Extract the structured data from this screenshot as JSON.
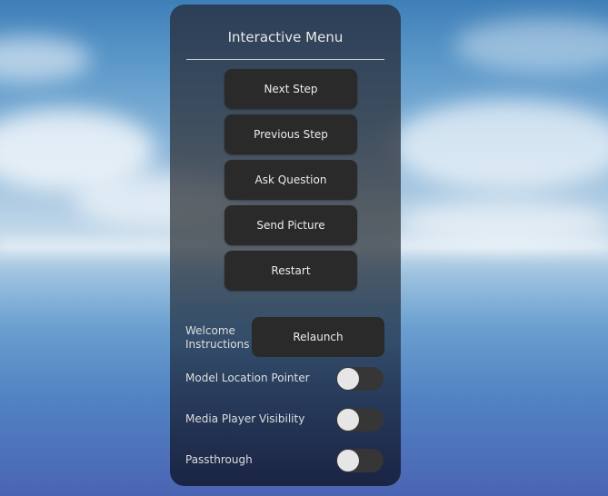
{
  "menu": {
    "title": "Interactive Menu",
    "buttons": [
      "Next Step",
      "Previous Step",
      "Ask Question",
      "Send Picture",
      "Restart"
    ]
  },
  "welcome": {
    "label_line1": "Welcome",
    "label_line2": "Instructions",
    "button_label": "Relaunch"
  },
  "toggles": [
    {
      "label": "Model Location Pointer",
      "state": "off"
    },
    {
      "label": "Media Player Visibility",
      "state": "off"
    },
    {
      "label": "Passthrough",
      "state": "off"
    }
  ]
}
